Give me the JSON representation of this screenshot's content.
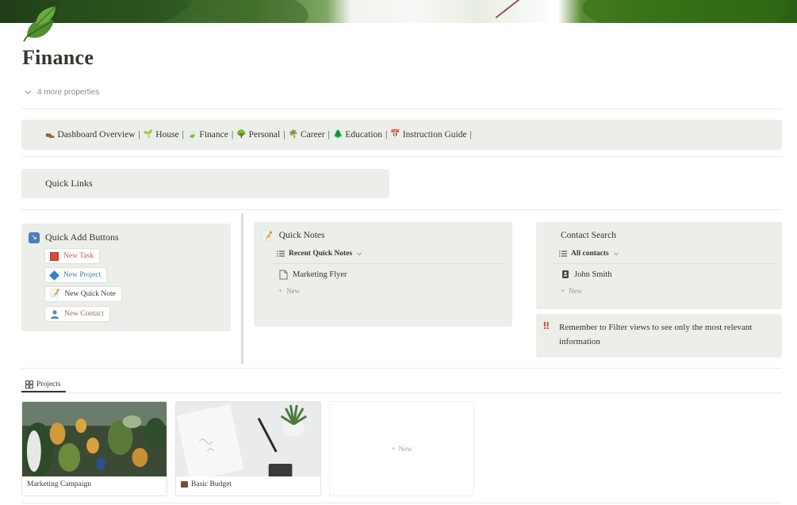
{
  "page": {
    "title": "Finance",
    "page_icon": "leaf-icon",
    "properties_toggle": "4 more properties"
  },
  "navbar": {
    "items": [
      {
        "icon": "boot-icon",
        "label": "Dashboard Overview"
      },
      {
        "icon": "potted-plant-icon",
        "label": "House"
      },
      {
        "icon": "leaf-icon",
        "label": "Finance"
      },
      {
        "icon": "tree-icon",
        "label": "Personal"
      },
      {
        "icon": "palm-tree-icon",
        "label": "Career"
      },
      {
        "icon": "pine-tree-icon",
        "label": "Education"
      },
      {
        "icon": "calendar-icon",
        "label": "Instruction Guide"
      }
    ],
    "separator": "|"
  },
  "quick_links": {
    "title": "Quick Links"
  },
  "quick_add": {
    "title": "Quick Add Buttons",
    "buttons": [
      {
        "label": "New Task",
        "icon": "red-square-icon",
        "color": "#c4554d"
      },
      {
        "label": "New Project",
        "icon": "blue-diamond-icon",
        "color": "#337ea9"
      },
      {
        "label": "New Quick Note",
        "icon": "memo-icon",
        "color": "#37352f"
      },
      {
        "label": "New Contact",
        "icon": "person-icon",
        "color": "#9f6b53"
      }
    ]
  },
  "quick_notes": {
    "title": "Quick Notes",
    "view_label": "Recent Quick Notes",
    "items": [
      "Marketing Flyer"
    ],
    "new_label": "New"
  },
  "contact_search": {
    "title": "Contact Search",
    "view_label": "All contacts",
    "items": [
      "John Smith"
    ],
    "new_label": "New"
  },
  "reminder": {
    "icon": "double-exclamation-icon",
    "text": "Remember to Filter views to see only the most relevant information"
  },
  "projects": {
    "tab_label": "Projects",
    "cards": [
      {
        "title": "Marketing Campaign",
        "icon": ""
      },
      {
        "title": "Basic Budget",
        "icon": "briefcase-icon"
      }
    ],
    "new_label": "New"
  },
  "colors": {
    "callout_bg": "#ebeee9",
    "text": "#37352f",
    "muted": "#9b9a97",
    "alert": "#d44c47"
  }
}
